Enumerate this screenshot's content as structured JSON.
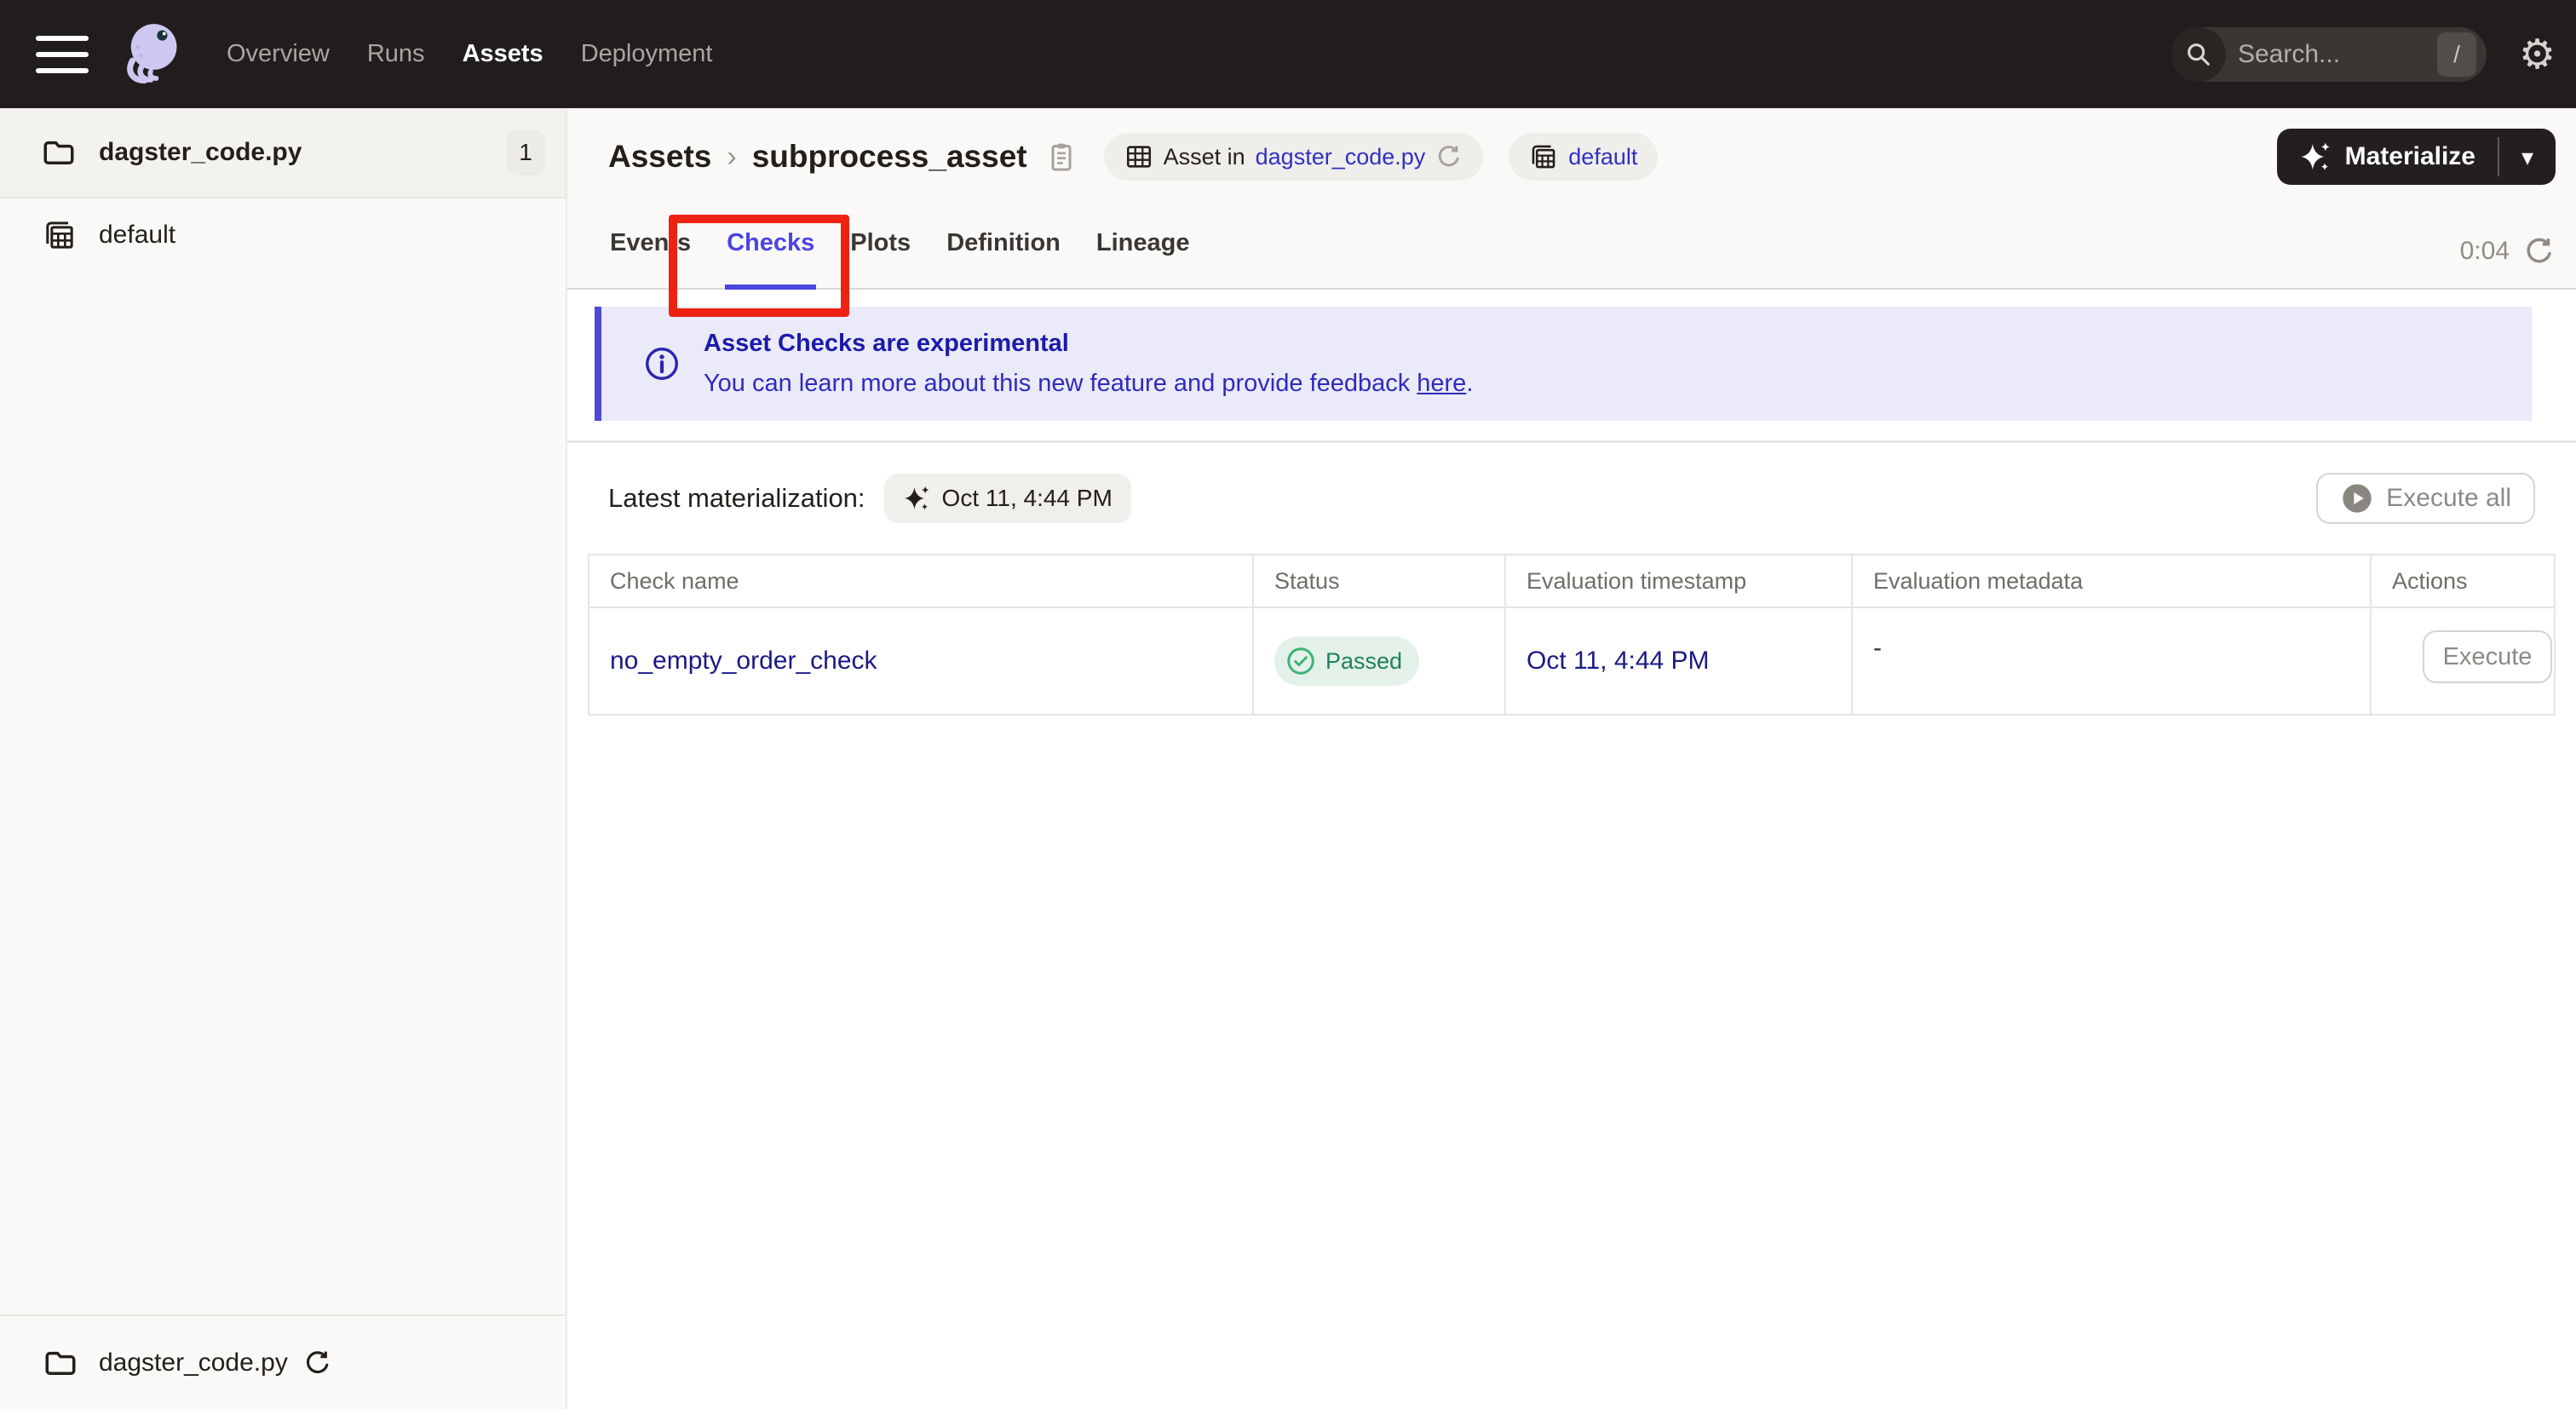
{
  "topnav": {
    "items": [
      {
        "label": "Overview",
        "active": false
      },
      {
        "label": "Runs",
        "active": false
      },
      {
        "label": "Assets",
        "active": true
      },
      {
        "label": "Deployment",
        "active": false
      }
    ],
    "search": {
      "placeholder": "Search...",
      "shortcut": "/"
    },
    "gear_glyph": "⚙"
  },
  "sidebar": {
    "groups": [
      {
        "label": "dagster_code.py",
        "count": "1"
      },
      {
        "label": "default"
      }
    ],
    "footer": {
      "label": "dagster_code.py"
    }
  },
  "header": {
    "breadcrumb_root": "Assets",
    "separator": "›",
    "asset_name": "subprocess_asset",
    "asset_pill_prefix": "Asset in",
    "asset_pill_link": "dagster_code.py",
    "group_pill_label": "default",
    "materialize_label": "Materialize",
    "caret_glyph": "▾"
  },
  "tabs": {
    "items": [
      {
        "label": "Events",
        "active": false
      },
      {
        "label": "Checks",
        "active": true
      },
      {
        "label": "Plots",
        "active": false
      },
      {
        "label": "Definition",
        "active": false
      },
      {
        "label": "Lineage",
        "active": false
      }
    ],
    "timer": "0:04"
  },
  "banner": {
    "title": "Asset Checks are experimental",
    "body_prefix": "You can learn more about this new feature and provide feedback ",
    "link_text": "here",
    "body_suffix": "."
  },
  "toolbar": {
    "latest_label": "Latest materialization:",
    "latest_value": "Oct 11, 4:44 PM",
    "execute_all_label": "Execute all"
  },
  "table": {
    "columns": [
      "Check name",
      "Status",
      "Evaluation timestamp",
      "Evaluation metadata",
      "Actions"
    ],
    "rows": [
      {
        "name": "no_empty_order_check",
        "status": "Passed",
        "timestamp": "Oct 11, 4:44 PM",
        "metadata": "-",
        "action_label": "Execute"
      }
    ]
  },
  "colors": {
    "accent_purple": "#4a45e3",
    "banner_purple_border": "#5049d8",
    "banner_bg": "#eaeaf8",
    "annotation_red": "#ee2213",
    "status_green": "#1f8353",
    "status_green_bg": "#e3f1e9",
    "table_link_navy": "#1a1a85",
    "nav_bg": "#211d1e",
    "page_header_bg": "#faf9f7"
  }
}
